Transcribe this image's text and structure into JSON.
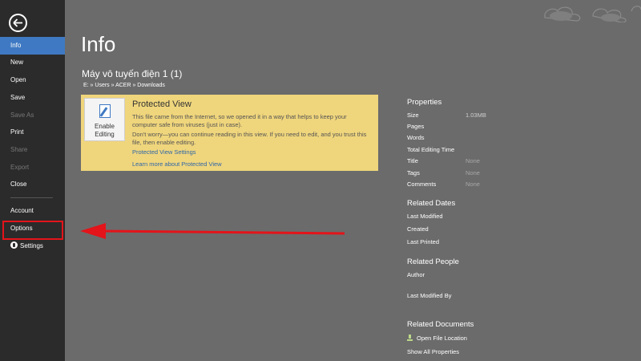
{
  "sidebar": {
    "items": [
      {
        "label": "Info"
      },
      {
        "label": "New"
      },
      {
        "label": "Open"
      },
      {
        "label": "Save"
      },
      {
        "label": "Save As"
      },
      {
        "label": "Print"
      },
      {
        "label": "Share"
      },
      {
        "label": "Export"
      },
      {
        "label": "Close"
      },
      {
        "label": "Account"
      },
      {
        "label": "Options"
      },
      {
        "label": "Settings"
      }
    ]
  },
  "main": {
    "page_title": "Info",
    "doc_title": "Máy vô tuyến điện 1 (1)",
    "doc_path": "E: » Users » ACER » Downloads"
  },
  "banner": {
    "enable_label_1": "Enable",
    "enable_label_2": "Editing",
    "title": "Protected View",
    "line1": "This file came from the Internet, so we opened it in a way that helps to keep your",
    "line2": "computer safe from viruses (just in case).",
    "line3": "Don't worry—you can continue reading in this view. If you need to edit, and you trust this",
    "line4": "file, then enable editing.",
    "link_settings": "Protected View Settings",
    "link_learn": "Learn more about Protected View"
  },
  "properties": {
    "heading": "Properties",
    "size_label": "Size",
    "size_value": "1.03MB",
    "pages_label": "Pages",
    "words_label": "Words",
    "editing_label": "Total Editing Time",
    "title_label": "Title",
    "title_value": "None",
    "tags_label": "Tags",
    "tags_value": "None",
    "comments_label": "Comments",
    "comments_value": "None"
  },
  "related_dates": {
    "heading": "Related Dates",
    "modified": "Last Modified",
    "created": "Created",
    "printed": "Last Printed"
  },
  "related_people": {
    "heading": "Related People",
    "author": "Author",
    "modified_by": "Last Modified By"
  },
  "related_documents": {
    "heading": "Related Documents",
    "open_location": "Open File Location",
    "show_all": "Show All Properties"
  },
  "colors": {
    "sidebar_bg": "#2b2b2b",
    "active": "#3f79c3",
    "main_bg": "#6b6b6b",
    "banner_bg": "#efd57c",
    "highlight_red": "#e3141a"
  }
}
